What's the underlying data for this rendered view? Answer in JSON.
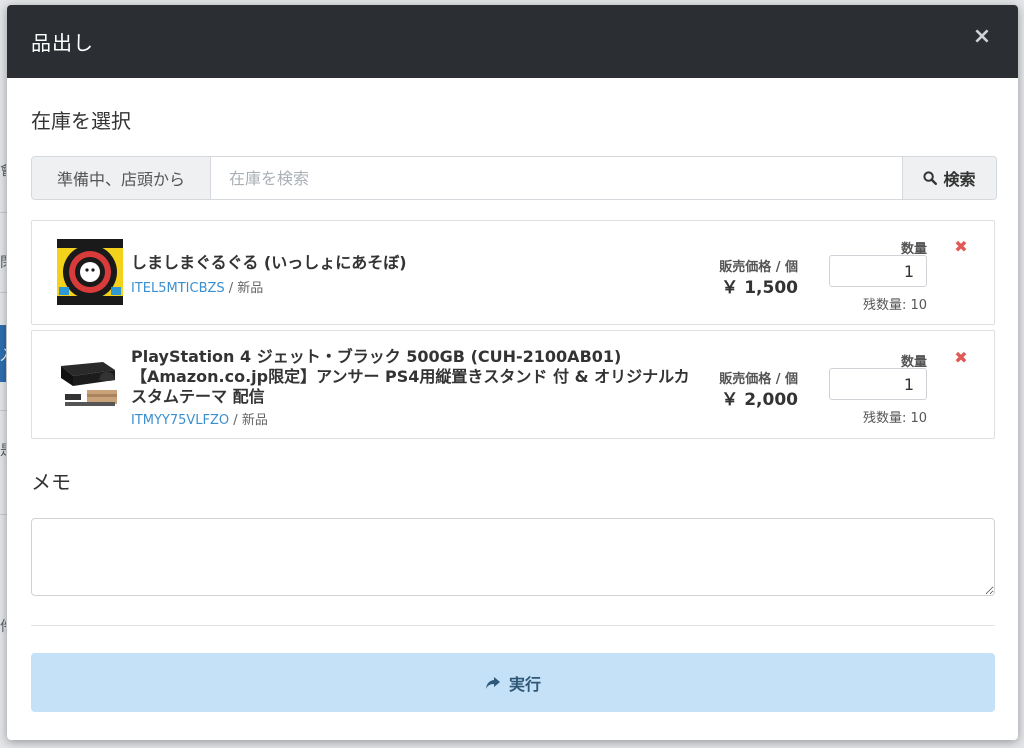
{
  "modal": {
    "title": "品出し",
    "close_label": "×"
  },
  "stock_section": {
    "title": "在庫を選択"
  },
  "search": {
    "prefix": "準備中、店頭から",
    "placeholder": "在庫を検索",
    "button_label": "検索"
  },
  "items": [
    {
      "name": "しましまぐるぐる (いっしょにあそぼ)",
      "code": "ITEL5MTICBZS",
      "condition": " / 新品",
      "price_label": "販売価格 / 個",
      "price": "￥ 1,500",
      "qty_label": "数量",
      "qty_value": "1",
      "stock": "残数量: 10",
      "remove": "✖"
    },
    {
      "name": "PlayStation 4 ジェット・ブラック 500GB (CUH-2100AB01) 【Amazon.co.jp限定】アンサー PS4用縦置きスタンド 付 & オリジナルカスタムテーマ 配信",
      "code": "ITMYY75VLFZO",
      "condition": " / 新品",
      "price_label": "販売価格 / 個",
      "price": "￥ 2,000",
      "qty_label": "数量",
      "qty_value": "1",
      "stock": "残数量: 10",
      "remove": "✖"
    }
  ],
  "memo": {
    "title": "メモ",
    "value": ""
  },
  "submit": {
    "label": "実行"
  },
  "colors": {
    "header_bg": "#2b2f33",
    "link": "#3a8fd0",
    "remove": "#e05a55",
    "submit_bg": "#c4e1f7",
    "submit_text": "#2f5878"
  },
  "background_fragments": [
    "會",
    "閉",
    "入",
    "是",
    "件"
  ]
}
